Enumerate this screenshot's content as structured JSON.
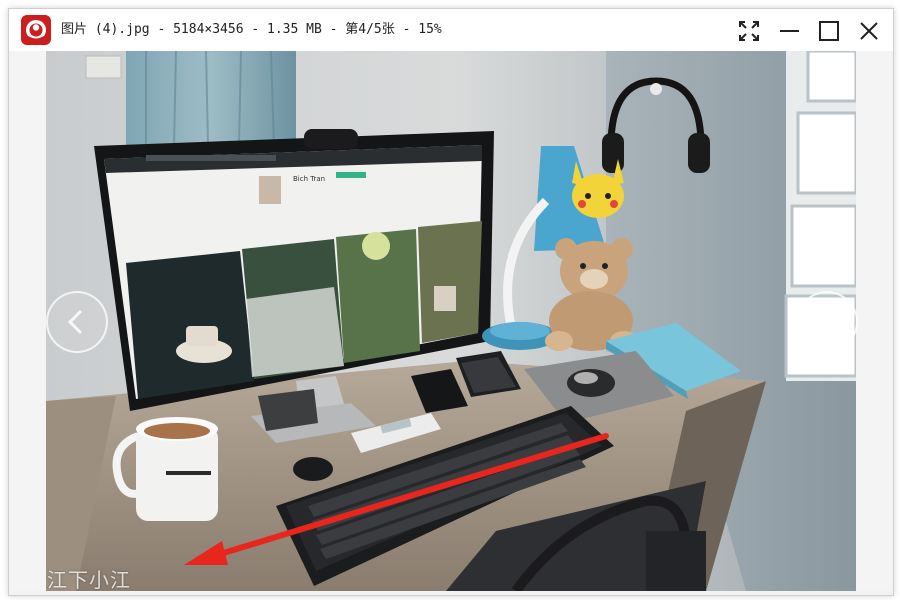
{
  "window": {
    "title": "图片 (4).jpg - 5184×3456 - 1.35 MB - 第4/5张 - 15%",
    "app_icon": "camera-lens-icon",
    "controls": [
      "fullscreen-icon",
      "minimize-icon",
      "maximize-icon",
      "close-icon"
    ]
  },
  "viewer": {
    "nav_prev_icon": "chevron-left-icon",
    "nav_next_icon": "chevron-right-icon",
    "watermark": "江下小江",
    "arrow_annotation_color": "#e8261d"
  },
  "photo": {
    "monitor_profile_name": "Bich Tran",
    "accent_lamp_color": "#4aa6cf"
  },
  "colors": {
    "brand_red": "#cc1e1e",
    "titlebar_bg": "#ffffff",
    "viewer_bg": "#f4f4f4"
  }
}
